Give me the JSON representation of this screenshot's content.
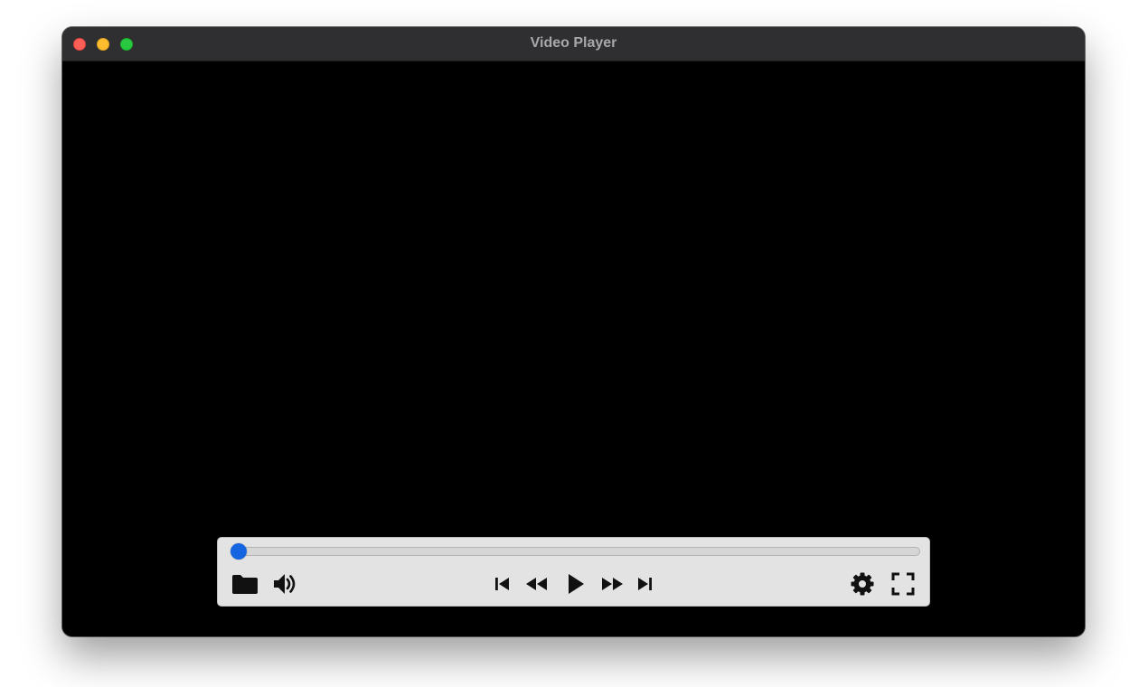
{
  "window": {
    "title": "Video Player"
  },
  "playback": {
    "progress": 0
  },
  "colors": {
    "accent": "#1565e0",
    "video_background": "#000000",
    "controls_background": "#e3e3e3",
    "titlebar": "#2f2f31"
  },
  "controls": {
    "left": [
      {
        "name": "open-file-button",
        "icon": "folder-icon"
      },
      {
        "name": "volume-button",
        "icon": "speaker-volume-icon"
      }
    ],
    "center": [
      {
        "name": "skip-previous-button",
        "icon": "skip-previous-icon"
      },
      {
        "name": "rewind-button",
        "icon": "rewind-icon"
      },
      {
        "name": "play-button",
        "icon": "play-icon"
      },
      {
        "name": "fast-forward-button",
        "icon": "fast-forward-icon"
      },
      {
        "name": "skip-next-button",
        "icon": "skip-next-icon"
      }
    ],
    "right": [
      {
        "name": "settings-button",
        "icon": "gear-icon"
      },
      {
        "name": "fullscreen-button",
        "icon": "fullscreen-icon"
      }
    ]
  }
}
